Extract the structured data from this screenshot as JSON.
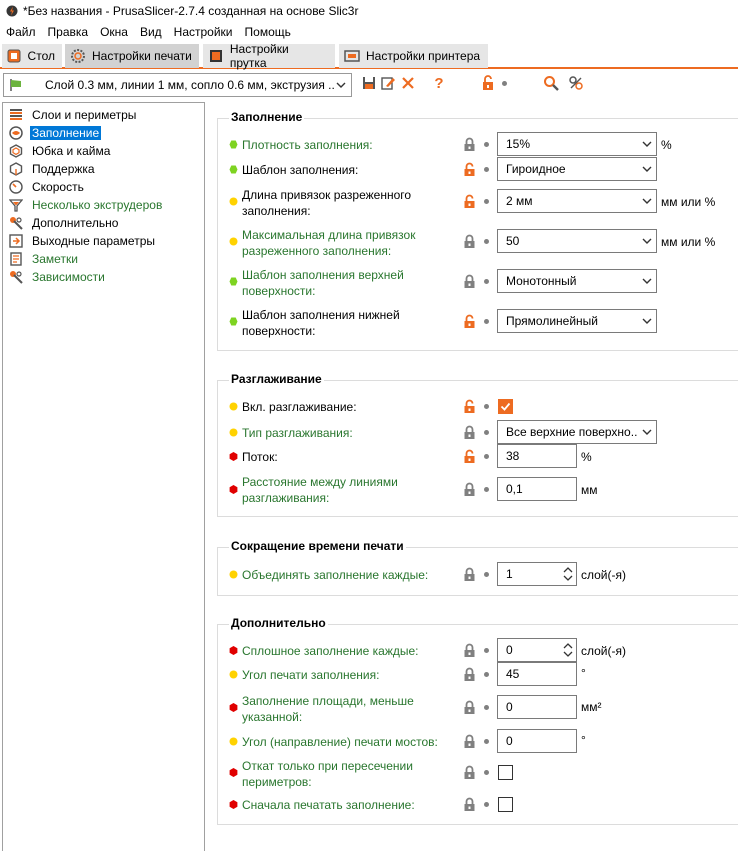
{
  "window": {
    "title": "*Без названия - PrusaSlicer-2.7.4 созданная на основе Slic3r"
  },
  "menu": [
    "Файл",
    "Правка",
    "Окна",
    "Вид",
    "Настройки",
    "Помощь"
  ],
  "tabs": [
    {
      "label": "Стол",
      "icon": "plater-icon"
    },
    {
      "label": "Настройки печати",
      "icon": "cog-icon"
    },
    {
      "label": "Настройки прутка",
      "icon": "spool-icon"
    },
    {
      "label": "Настройки принтера",
      "icon": "printer-icon"
    }
  ],
  "toolbar": {
    "preset": "Слой 0.3 мм, линии 1 мм, сопло 0.6 мм, экструзия ..."
  },
  "sidebar": {
    "items": [
      {
        "label": "Слои и периметры",
        "icon": "layers-icon"
      },
      {
        "label": "Заполнение",
        "icon": "infill-icon"
      },
      {
        "label": "Юбка и кайма",
        "icon": "skirt-icon"
      },
      {
        "label": "Поддержка",
        "icon": "support-icon"
      },
      {
        "label": "Скорость",
        "icon": "speed-icon"
      },
      {
        "label": "Несколько экструдеров",
        "icon": "funnel-icon"
      },
      {
        "label": "Дополнительно",
        "icon": "wrench-icon"
      },
      {
        "label": "Выходные параметры",
        "icon": "output-icon"
      },
      {
        "label": "Заметки",
        "icon": "notes-icon"
      },
      {
        "label": "Зависимости",
        "icon": "wrench-icon"
      }
    ]
  },
  "groups": {
    "infill": {
      "title": "Заполнение",
      "density": {
        "label": "Плотность заполнения:",
        "value": "15%",
        "unit": "%"
      },
      "pattern": {
        "label": "Шаблон заполнения:",
        "value": "Гироидное"
      },
      "anchor": {
        "label1": "Длина привязок разреженного",
        "label2": "заполнения:",
        "value": "2 мм",
        "unit": "мм или %"
      },
      "anchor_max": {
        "label1": "Максимальная длина привязок",
        "label2": "разреженного заполнения:",
        "value": "50",
        "unit": "мм или %"
      },
      "top_pattern": {
        "label1": "Шаблон заполнения верхней",
        "label2": "поверхности:",
        "value": "Монотонный"
      },
      "bottom_pattern": {
        "label1": "Шаблон заполнения нижней",
        "label2": "поверхности:",
        "value": "Прямолинейный"
      }
    },
    "ironing": {
      "title": "Разглаживание",
      "enable": {
        "label": "Вкл. разглаживание:"
      },
      "type": {
        "label": "Тип разглаживания:",
        "value": "Все верхние поверхно..."
      },
      "flow": {
        "label": "Поток:",
        "value": "38",
        "unit": "%"
      },
      "spacing": {
        "label1": "Расстояние между линиями",
        "label2": "разглаживания:",
        "value": "0,1",
        "unit": "мм"
      }
    },
    "reduce": {
      "title": "Сокращение времени печати",
      "combine": {
        "label": "Объединять заполнение каждые:",
        "value": "1",
        "unit": "слой(-я)"
      }
    },
    "advanced": {
      "title": "Дополнительно",
      "solid_every": {
        "label": "Сплошное заполнение каждые:",
        "value": "0",
        "unit": "слой(-я)"
      },
      "angle": {
        "label": "Угол печати заполнения:",
        "value": "45",
        "unit": "°"
      },
      "solid_area": {
        "label1": "Заполнение площади, меньше",
        "label2": "указанной:",
        "value": "0",
        "unit": "мм²"
      },
      "bridge_angle": {
        "label": "Угол (направление) печати мостов:",
        "value": "0",
        "unit": "°"
      },
      "retract": {
        "label1": "Откат только при пересечении",
        "label2": "периметров:"
      },
      "infill_first": {
        "label": "Сначала печатать заполнение:"
      }
    }
  },
  "colors": {
    "accent": "#ed6b21",
    "green_label": "#29762e",
    "mode_simple": "#00b000",
    "mode_advanced": "#ffd200",
    "mode_expert": "#e00000"
  }
}
